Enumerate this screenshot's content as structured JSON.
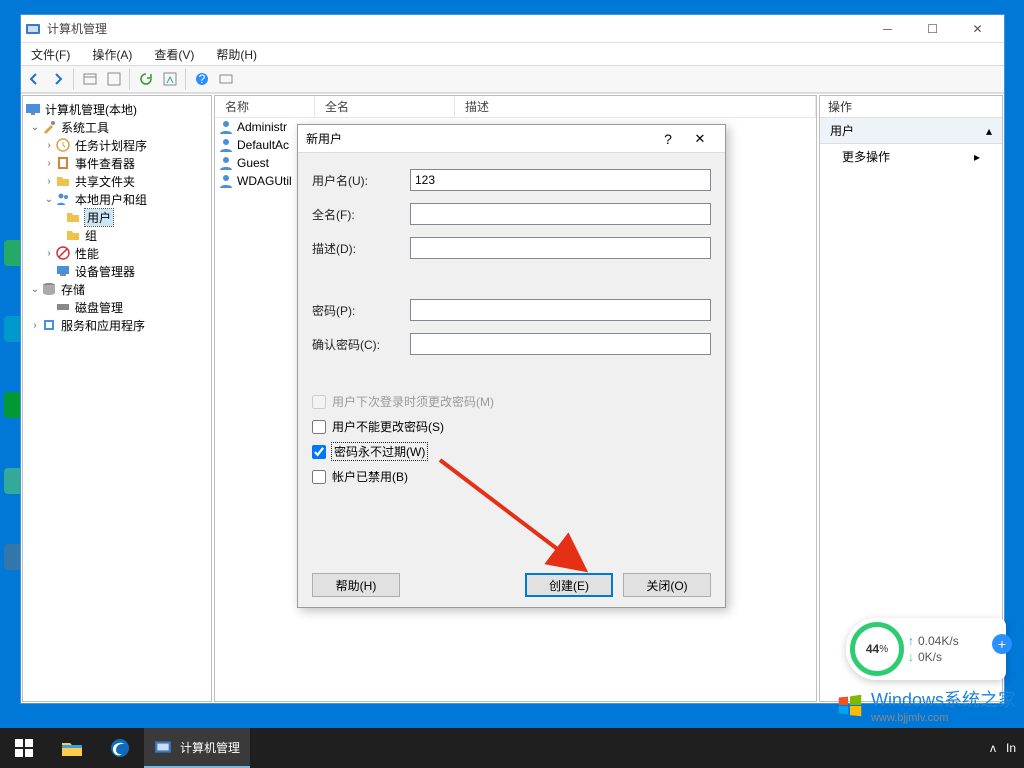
{
  "window": {
    "title": "计算机管理",
    "menus": [
      "文件(F)",
      "操作(A)",
      "查看(V)",
      "帮助(H)"
    ]
  },
  "tree": {
    "root": "计算机管理(本地)",
    "system_tools": "系统工具",
    "task_scheduler": "任务计划程序",
    "event_viewer": "事件查看器",
    "shared_folders": "共享文件夹",
    "local_users": "本地用户和组",
    "users": "用户",
    "groups": "组",
    "performance": "性能",
    "device_mgr": "设备管理器",
    "storage": "存储",
    "disk_mgmt": "磁盘管理",
    "services_apps": "服务和应用程序"
  },
  "list": {
    "columns": {
      "name": "名称",
      "fullname": "全名",
      "description": "描述"
    },
    "rows": [
      {
        "name": "Administr"
      },
      {
        "name": "DefaultAc"
      },
      {
        "name": "Guest"
      },
      {
        "name": "WDAGUtil"
      }
    ]
  },
  "actions": {
    "header": "操作",
    "group": "用户",
    "more": "更多操作"
  },
  "dialog": {
    "title": "新用户",
    "fields": {
      "username_label": "用户名(U):",
      "username_value": "123",
      "fullname_label": "全名(F):",
      "fullname_value": "",
      "description_label": "描述(D):",
      "description_value": "",
      "password_label": "密码(P):",
      "password_value": "",
      "confirm_label": "确认密码(C):",
      "confirm_value": ""
    },
    "checkboxes": {
      "must_change": "用户下次登录时须更改密码(M)",
      "cannot_change": "用户不能更改密码(S)",
      "never_expire": "密码永不过期(W)",
      "disabled": "帐户已禁用(B)"
    },
    "buttons": {
      "help": "帮助(H)",
      "create": "创建(E)",
      "close": "关闭(O)"
    }
  },
  "speed": {
    "percent": "44",
    "percent_suffix": "%",
    "up": "0.04K/s",
    "down": "0K/s"
  },
  "watermark": {
    "main": "Windows系统之家",
    "sub": "www.bjjmlv.com"
  },
  "taskbar": {
    "active_task": "计算机管理",
    "tray": {
      "ime": "In"
    }
  }
}
